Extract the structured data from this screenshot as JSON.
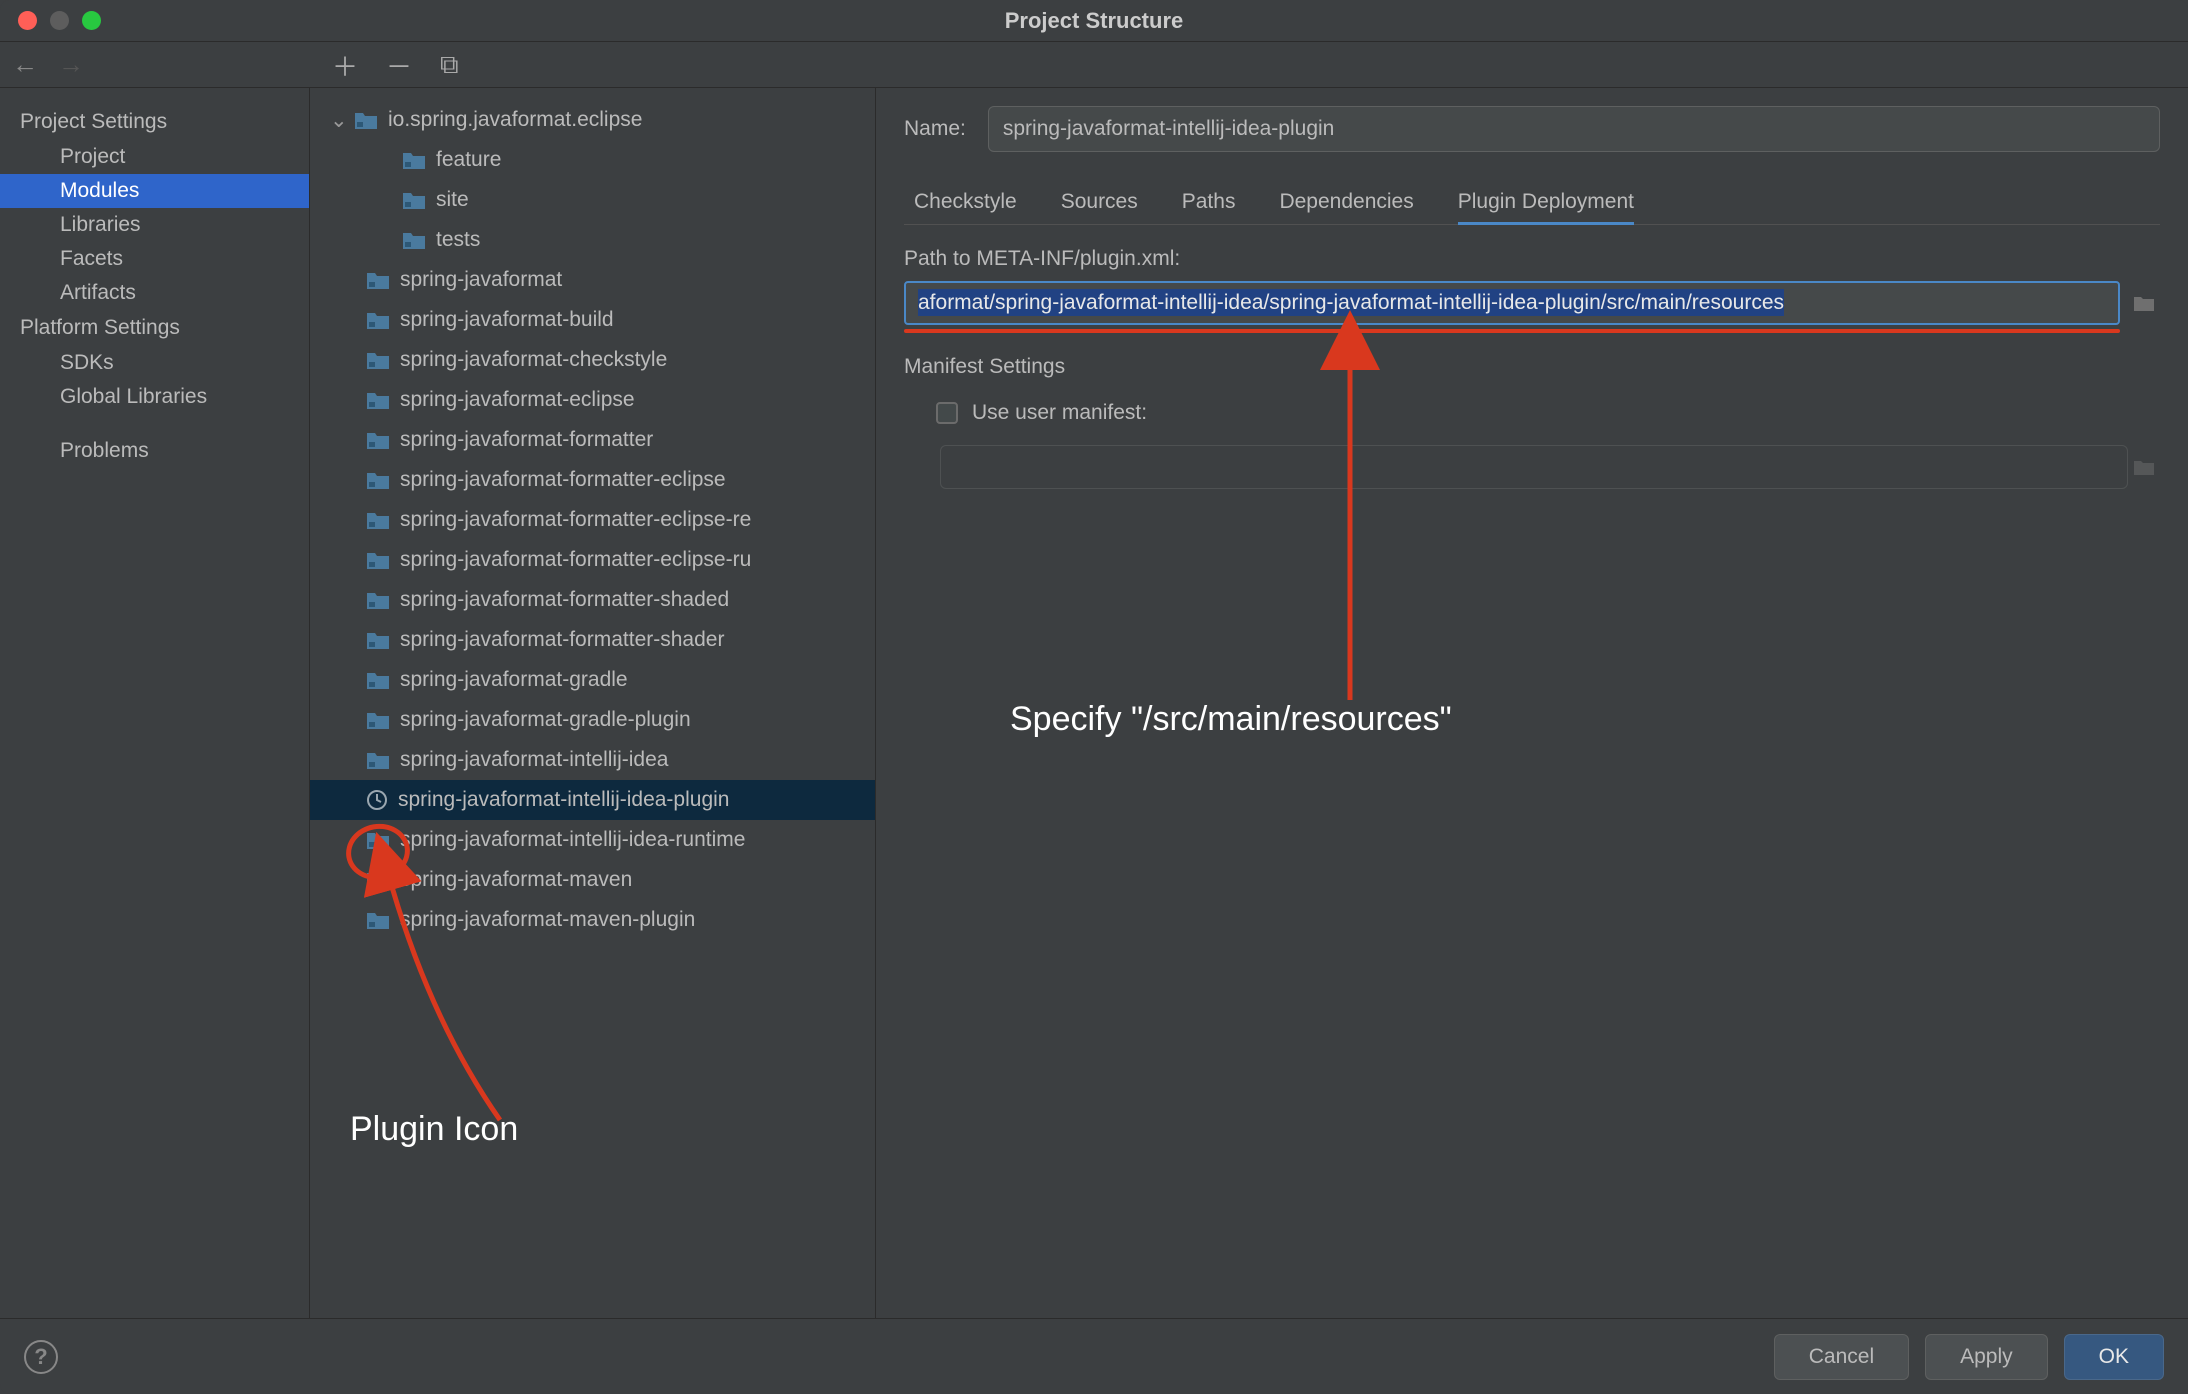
{
  "window": {
    "title": "Project Structure"
  },
  "sidebar": {
    "sections": [
      {
        "header": "Project Settings",
        "items": [
          "Project",
          "Modules",
          "Libraries",
          "Facets",
          "Artifacts"
        ],
        "selected": "Modules"
      },
      {
        "header": "Platform Settings",
        "items": [
          "SDKs",
          "Global Libraries"
        ]
      },
      {
        "header": "",
        "items": [
          "Problems"
        ]
      }
    ]
  },
  "tree": {
    "root": "io.spring.javaformat.eclipse",
    "root_children": [
      "feature",
      "site",
      "tests"
    ],
    "modules": [
      "spring-javaformat",
      "spring-javaformat-build",
      "spring-javaformat-checkstyle",
      "spring-javaformat-eclipse",
      "spring-javaformat-formatter",
      "spring-javaformat-formatter-eclipse",
      "spring-javaformat-formatter-eclipse-re",
      "spring-javaformat-formatter-eclipse-ru",
      "spring-javaformat-formatter-shaded",
      "spring-javaformat-formatter-shader",
      "spring-javaformat-gradle",
      "spring-javaformat-gradle-plugin",
      "spring-javaformat-intellij-idea",
      "spring-javaformat-intellij-idea-plugin",
      "spring-javaformat-intellij-idea-runtime",
      "spring-javaformat-maven",
      "spring-javaformat-maven-plugin"
    ],
    "selected": "spring-javaformat-intellij-idea-plugin"
  },
  "detail": {
    "name_label": "Name:",
    "name_value": "spring-javaformat-intellij-idea-plugin",
    "tabs": [
      "Checkstyle",
      "Sources",
      "Paths",
      "Dependencies",
      "Plugin Deployment"
    ],
    "selected_tab": "Plugin Deployment",
    "path_label": "Path to META-INF/plugin.xml:",
    "path_value": "aformat/spring-javaformat-intellij-idea/spring-javaformat-intellij-idea-plugin/src/main/resources",
    "manifest_header": "Manifest Settings",
    "use_user_manifest": "Use user manifest:"
  },
  "footer": {
    "cancel": "Cancel",
    "apply": "Apply",
    "ok": "OK"
  },
  "annotations": {
    "plugin_icon": "Plugin Icon",
    "specify": "Specify \"/src/main/resources\""
  }
}
